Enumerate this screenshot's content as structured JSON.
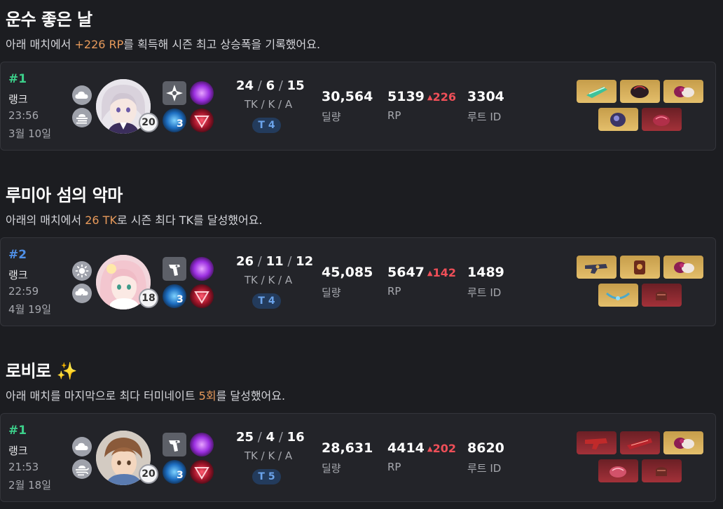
{
  "sections": [
    {
      "title": "운수 좋은 날",
      "subtitle_pre": "아래 매치에서 ",
      "subtitle_hl": "+226 RP",
      "subtitle_post": "를 획득해 시즌 최고 상승폭을 기록했어요.",
      "match": {
        "rank": "#1",
        "rank_color": "#3ccf8a",
        "rank_label": "랭크",
        "time": "23:56",
        "date": "3월 10일",
        "weather": [
          "cloud-icon",
          "fog-icon"
        ],
        "level": "20",
        "tk": "24",
        "k": "6",
        "a": "15",
        "kda_label": "TK / K / A",
        "tier": "T 4",
        "damage": "30,564",
        "damage_label": "딜량",
        "rp": "5139",
        "rp_delta": "226",
        "rp_label": "RP",
        "route": "3304",
        "route_label": "루트 ID",
        "items": [
          "gold",
          "gold",
          "gold",
          "gold",
          "red"
        ]
      }
    },
    {
      "title": "루미아 섬의 악마",
      "subtitle_pre": "아래의 매치에서 ",
      "subtitle_hl": "26 TK",
      "subtitle_post": "로 시즌 최다 TK를 달성했어요.",
      "match": {
        "rank": "#2",
        "rank_color": "#4f8fe6",
        "rank_label": "랭크",
        "time": "22:59",
        "date": "4월 19일",
        "weather": [
          "sun-icon",
          "storm-icon"
        ],
        "level": "18",
        "tk": "26",
        "k": "11",
        "a": "12",
        "kda_label": "TK / K / A",
        "tier": "T 4",
        "damage": "45,085",
        "damage_label": "딜량",
        "rp": "5647",
        "rp_delta": "142",
        "rp_label": "RP",
        "route": "1489",
        "route_label": "루트 ID",
        "items": [
          "gold",
          "gold",
          "gold",
          "gold",
          "red"
        ]
      }
    },
    {
      "title": "로비로 ✨",
      "subtitle_pre": "아래 매치를 마지막으로 최다 터미네이트 ",
      "subtitle_hl": "5회",
      "subtitle_post": "를 달성했어요.",
      "match": {
        "rank": "#1",
        "rank_color": "#3ccf8a",
        "rank_label": "랭크",
        "time": "21:53",
        "date": "2월 18일",
        "weather": [
          "cloud-icon",
          "wind-icon"
        ],
        "level": "20",
        "tk": "25",
        "k": "4",
        "a": "16",
        "kda_label": "TK / K / A",
        "tier": "T 5",
        "damage": "28,631",
        "damage_label": "딜량",
        "rp": "4414",
        "rp_delta": "202",
        "rp_label": "RP",
        "route": "8620",
        "route_label": "루트 ID",
        "items": [
          "red",
          "red",
          "gold",
          "red",
          "red"
        ]
      }
    }
  ],
  "skill_level": "3",
  "colors": {
    "accent_orange": "#e79a5b",
    "rp_up": "#ef4f58",
    "tier_bg": "#233b5c"
  }
}
